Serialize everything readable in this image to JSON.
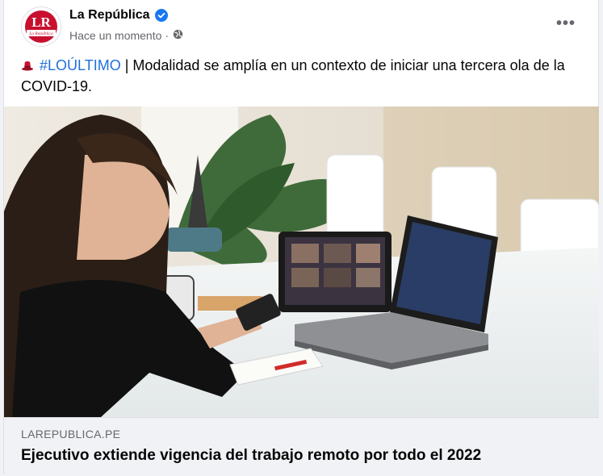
{
  "post": {
    "page_name": "La República",
    "timestamp": "Hace un momento",
    "audience_icon": "globe-icon",
    "more_icon": "more-options-icon",
    "more_label": "•••",
    "avatar_logo_text": "LR",
    "avatar_logo_subtext": "La República",
    "text_emoji_icon": "red-hat-emoji-icon",
    "hashtag": "#LOÚLTIMO",
    "separator": " | ",
    "text_body": "Modalidad se amplía en un contexto de iniciar una tercera ola de la COVID-19."
  },
  "link_preview": {
    "domain": "LAREPUBLICA.PE",
    "headline": "Ejecutivo extiende vigencia del trabajo remoto por todo el 2022"
  },
  "colors": {
    "brand_red": "#c8102e",
    "verified_blue": "#1877f2",
    "hashtag_blue": "#216fdb",
    "text_primary": "#050505",
    "text_secondary": "#65676b",
    "footer_bg": "#f0f2f5"
  }
}
